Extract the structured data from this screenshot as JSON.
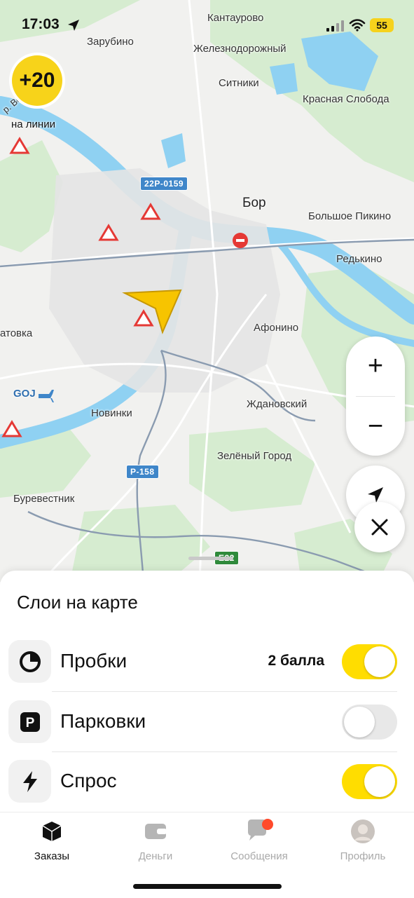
{
  "status_bar": {
    "time": "17:03",
    "battery": "55"
  },
  "bonus": {
    "value": "+20",
    "label": "на линии"
  },
  "map": {
    "places": [
      {
        "key": "kantaurovo",
        "text": "Кантаурово"
      },
      {
        "key": "zarubino",
        "text": "Зарубино"
      },
      {
        "key": "zheleznodorozhny",
        "text": "Железнодорожный"
      },
      {
        "key": "sitniki",
        "text": "Ситники"
      },
      {
        "key": "krasnaya",
        "text": "Красная Слобода"
      },
      {
        "key": "bor",
        "text": "Бор"
      },
      {
        "key": "pikino",
        "text": "Большое Пикино"
      },
      {
        "key": "redkino",
        "text": "Редькино"
      },
      {
        "key": "afonino",
        "text": "Афонино"
      },
      {
        "key": "atovka",
        "text": "атовка"
      },
      {
        "key": "goj",
        "text": "GOJ"
      },
      {
        "key": "novinki",
        "text": "Новинки"
      },
      {
        "key": "zhdanovsky",
        "text": "Ждановский"
      },
      {
        "key": "zelgorod",
        "text": "Зелёный Город"
      },
      {
        "key": "burevestnik",
        "text": "Буревестник"
      }
    ],
    "road_shields": [
      {
        "key": "r1",
        "text": "22Р-0159",
        "color": "#3f86c9"
      },
      {
        "key": "r2",
        "text": "Р-158",
        "color": "#3f86c9"
      },
      {
        "key": "r3",
        "text": "E22",
        "color": "#2f8a3b"
      }
    ],
    "river_label": "р. Во"
  },
  "map_controls": {
    "zoom_in": "+",
    "zoom_out": "−"
  },
  "layers_sheet": {
    "title": "Слои на карте",
    "items": [
      {
        "label": "Пробки",
        "value": "2 балла",
        "enabled": true,
        "icon": "traffic-icon"
      },
      {
        "label": "Парковки",
        "value": "",
        "enabled": false,
        "icon": "parking-icon"
      },
      {
        "label": "Спрос",
        "value": "",
        "enabled": true,
        "icon": "lightning-icon"
      }
    ]
  },
  "tabbar": {
    "tabs": [
      {
        "label": "Заказы",
        "icon": "orders-icon",
        "active": true
      },
      {
        "label": "Деньги",
        "icon": "wallet-icon",
        "active": false
      },
      {
        "label": "Сообщения",
        "icon": "messages-icon",
        "active": false
      },
      {
        "label": "Профиль",
        "icon": "avatar",
        "active": false
      }
    ]
  },
  "colors": {
    "accent": "#ffdd00",
    "water": "#8fd1f2",
    "forest": "#cfe8c8",
    "notification": "#ff4a2b"
  }
}
